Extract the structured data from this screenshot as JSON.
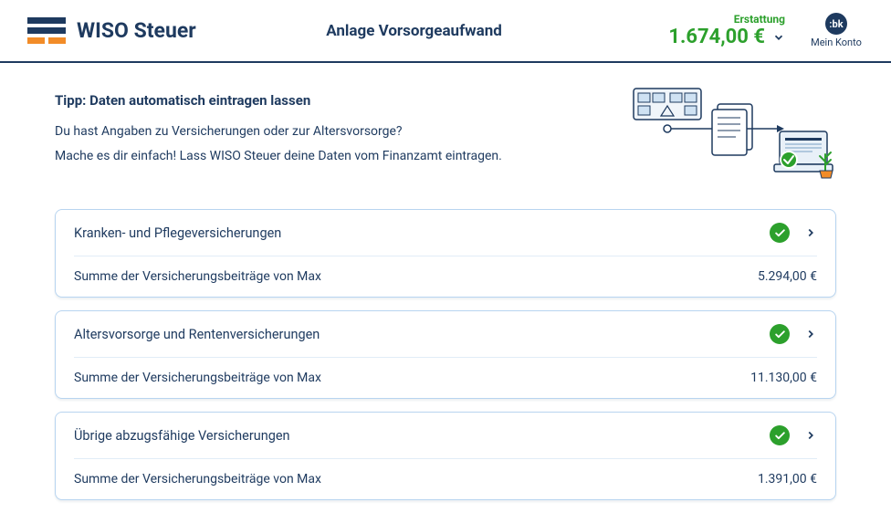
{
  "logo": {
    "text": "WISO Steuer"
  },
  "page_title": "Anlage Vorsorgeaufwand",
  "refund": {
    "label": "Erstattung",
    "amount": "1.674,00 €"
  },
  "account": {
    "icon_text": ":bk",
    "label": "Mein Konto"
  },
  "tip": {
    "title": "Tipp: Daten automatisch eintragen lassen",
    "line1": "Du hast Angaben zu Versicherungen oder zur Altersvorsorge?",
    "line2": "Mache es dir einfach! Lass WISO Steuer deine Daten vom Finanzamt eintragen."
  },
  "cards": [
    {
      "title": "Kranken- und Pflegeversicherungen",
      "sum_label": "Summe der Versicherungsbeiträge von Max",
      "sum_value": "5.294,00 €"
    },
    {
      "title": "Altersvorsorge und Rentenversicherungen",
      "sum_label": "Summe der Versicherungsbeiträge von Max",
      "sum_value": "11.130,00 €"
    },
    {
      "title": "Übrige abzugsfähige Versicherungen",
      "sum_label": "Summe der Versicherungsbeiträge von Max",
      "sum_value": "1.391,00 €"
    }
  ]
}
